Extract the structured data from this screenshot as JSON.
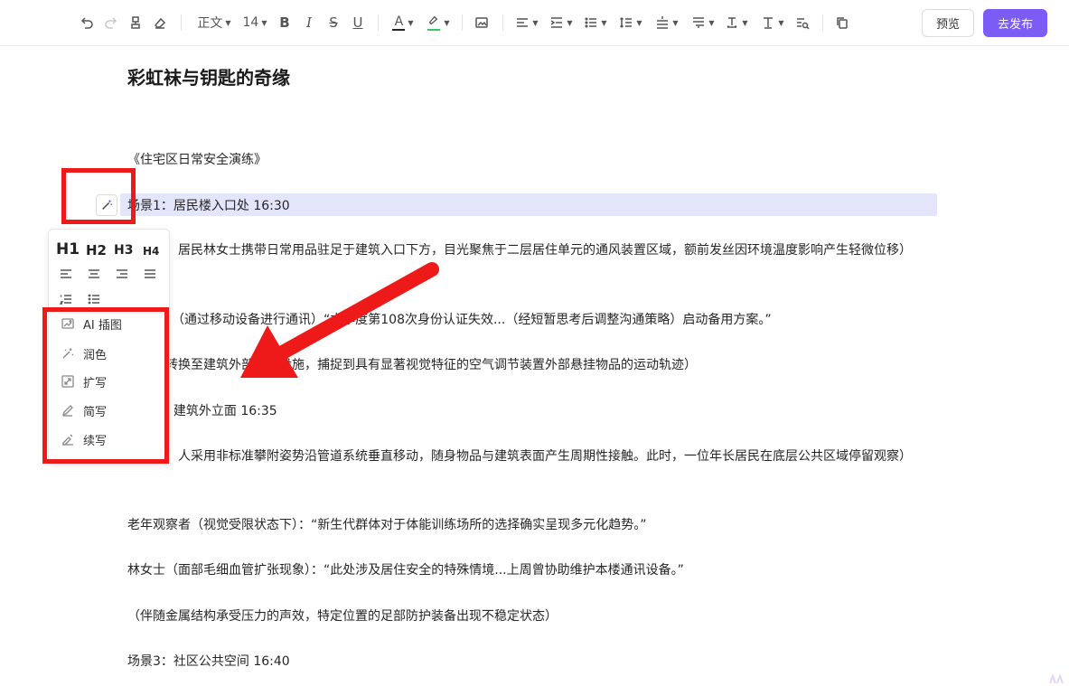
{
  "toolbar": {
    "paragraph_style": "正文",
    "font_size": "14",
    "preview_label": "预览",
    "publish_label": "去发布",
    "font_color": "#222222",
    "highlight_color": "#3cc46a",
    "accent_color": "#7b5cf5"
  },
  "document": {
    "title": "彩虹袜与钥匙的奇缘",
    "paragraphs": [
      "《住宅区日常安全演练》",
      "场景1：居民楼入口处 16:30",
      "（镜头：居民林女士携带日常用品驻足于建筑入口下方，目光聚焦于二层居住单元的通风装置区域，额前发丝因环境温度影响产生轻微位移）",
      "林女士：（通过移动设备进行通讯）“本季度第108次身份认证失效...（经短暂思考后调整沟通策略）启动备用方案。”",
      "（镜头转换至建筑外部附属设施，捕捉到具有显著视觉特征的空气调节装置外部悬挂物品的运动轨迹）",
      "场景2：建筑外立面 16:35",
      "（镜头：人采用非标准攀附姿势沿管道系统垂直移动，随身物品与建筑表面产生周期性接触。此时，一位年长居民在底层公共区域停留观察）",
      "老年观察者（视觉受限状态下）：“新生代群体对于体能训练场所的选择确实呈现多元化趋势。”",
      "林女士（面部毛细血管扩张现象）：“此处涉及居住安全的特殊情境...上周曾协助维护本楼通讯设备。”",
      "（伴随金属结构承受压力的声效，特定位置的足部防护装备出现不稳定状态）",
      "场景3：社区公共空间 16:40"
    ]
  },
  "panel": {
    "headings": [
      "H1",
      "H2",
      "H3",
      "H4"
    ],
    "menu": [
      {
        "label": "AI 插图",
        "icon": "image-ai-icon"
      },
      {
        "label": "润色",
        "icon": "polish-icon"
      },
      {
        "label": "扩写",
        "icon": "expand-icon"
      },
      {
        "label": "简写",
        "icon": "pen-icon"
      },
      {
        "label": "续写",
        "icon": "continue-write-icon"
      }
    ]
  },
  "annotation_color": "#ee1a1a"
}
